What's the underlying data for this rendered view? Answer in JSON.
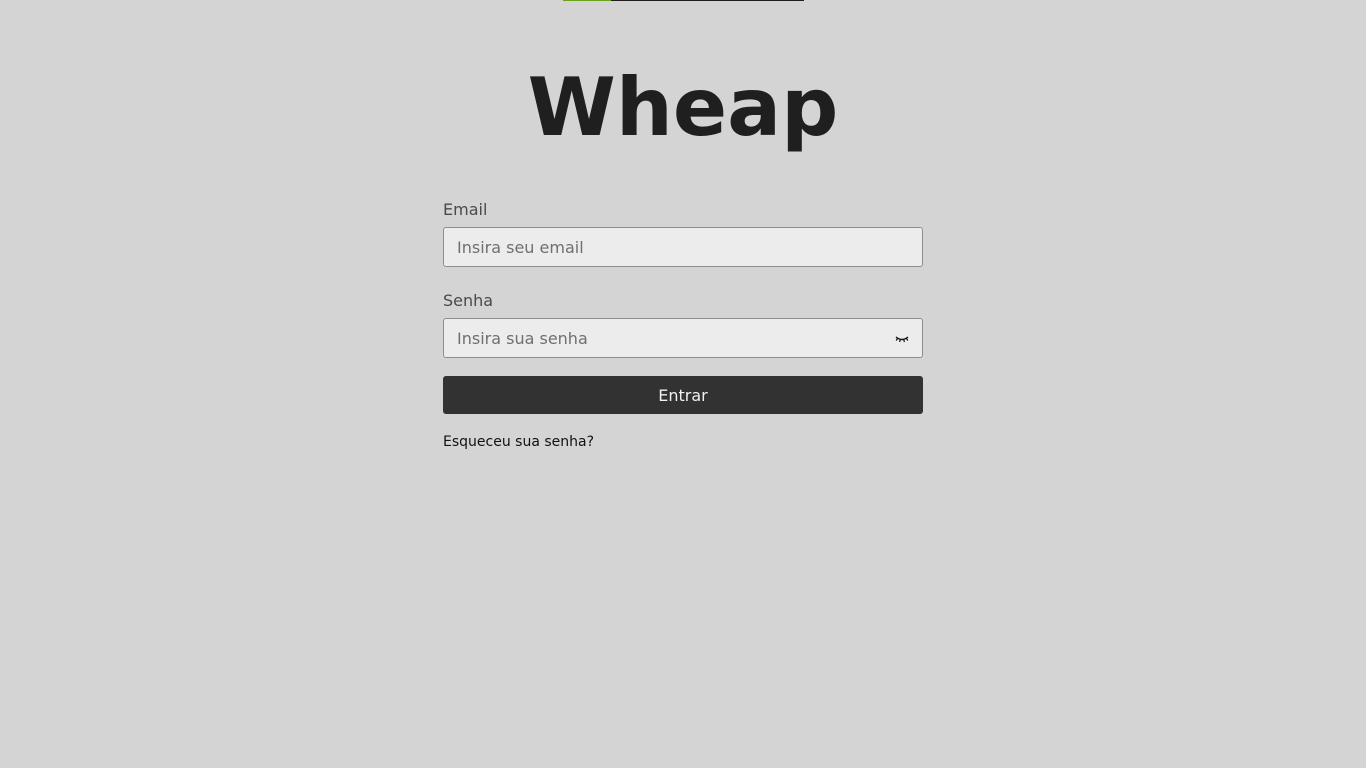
{
  "progress": {
    "fraction": 0.2,
    "fill_color": "#6aa21e",
    "track_color": "#1e1e1e"
  },
  "brand": {
    "logo_text": "Wheap"
  },
  "login_form": {
    "email": {
      "label": "Email",
      "placeholder": "Insira seu email",
      "value": ""
    },
    "password": {
      "label": "Senha",
      "placeholder": "Insira sua senha",
      "value": "",
      "toggle_icon": "eye-closed-icon"
    },
    "submit_label": "Entrar",
    "forgot_password_label": "Esqueceu sua senha?"
  },
  "colors": {
    "background": "#d4d4d4",
    "button_bg": "#323232",
    "input_bg": "#ececec"
  }
}
